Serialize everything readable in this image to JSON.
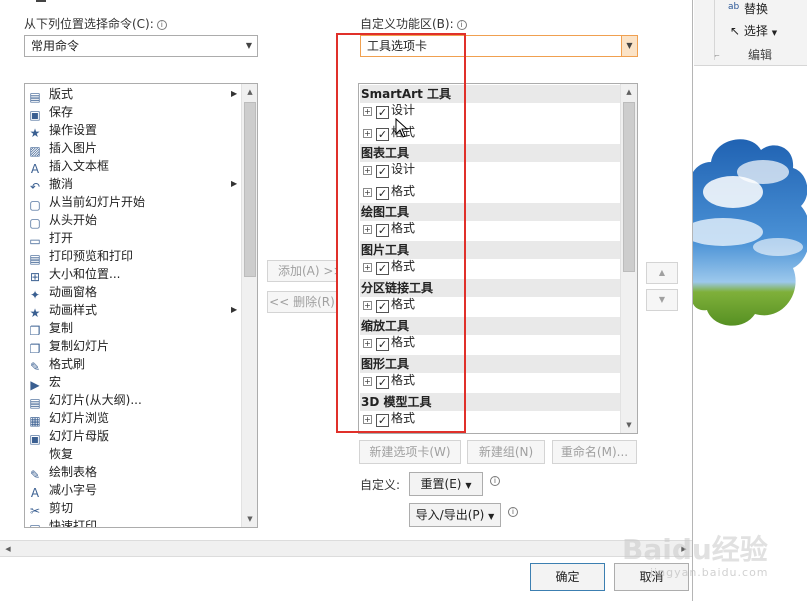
{
  "left_panel": {
    "label": "从下列位置选择命令(C):",
    "combo_value": "常用命令",
    "commands": [
      {
        "label": "版式",
        "icon": "layout-icon",
        "sub": true
      },
      {
        "label": "保存",
        "icon": "save-icon",
        "sub": false
      },
      {
        "label": "操作设置",
        "icon": "action-star-icon",
        "sub": false
      },
      {
        "label": "插入图片",
        "icon": "insert-picture-icon",
        "sub": false
      },
      {
        "label": "插入文本框",
        "icon": "insert-textbox-icon",
        "sub": false
      },
      {
        "label": "撤消",
        "icon": "undo-icon",
        "sub": true
      },
      {
        "label": "从当前幻灯片开始",
        "icon": "slideshow-current-icon",
        "sub": false
      },
      {
        "label": "从头开始",
        "icon": "slideshow-start-icon",
        "sub": false
      },
      {
        "label": "打开",
        "icon": "open-folder-icon",
        "sub": false
      },
      {
        "label": "打印预览和打印",
        "icon": "print-preview-icon",
        "sub": false
      },
      {
        "label": "大小和位置...",
        "icon": "size-position-icon",
        "sub": false
      },
      {
        "label": "动画窗格",
        "icon": "animation-pane-icon",
        "sub": false
      },
      {
        "label": "动画样式",
        "icon": "animation-style-icon",
        "sub": true
      },
      {
        "label": "复制",
        "icon": "copy-icon",
        "sub": false
      },
      {
        "label": "复制幻灯片",
        "icon": "duplicate-slide-icon",
        "sub": false
      },
      {
        "label": "格式刷",
        "icon": "format-painter-icon",
        "sub": false
      },
      {
        "label": "宏",
        "icon": "macro-icon",
        "sub": false
      },
      {
        "label": "幻灯片(从大纲)...",
        "icon": "slides-from-outline-icon",
        "sub": false
      },
      {
        "label": "幻灯片浏览",
        "icon": "slide-sorter-icon",
        "sub": false
      },
      {
        "label": "幻灯片母版",
        "icon": "slide-master-icon",
        "sub": false
      },
      {
        "label": "恢复",
        "icon": "redo-icon",
        "sub": false
      },
      {
        "label": "绘制表格",
        "icon": "draw-table-icon",
        "sub": false
      },
      {
        "label": "减小字号",
        "icon": "decrease-font-icon",
        "sub": false
      },
      {
        "label": "剪切",
        "icon": "cut-icon",
        "sub": false
      },
      {
        "label": "快速打印",
        "icon": "quick-print-icon",
        "sub": false
      }
    ]
  },
  "middle": {
    "add_label": "添加(A) >>",
    "remove_label": "<< 删除(R)"
  },
  "right_panel": {
    "label": "自定义功能区(B):",
    "combo_value": "工具选项卡",
    "tree": [
      {
        "group": "SmartArt 工具",
        "items": [
          "设计",
          "格式"
        ]
      },
      {
        "group": "图表工具",
        "items": [
          "设计",
          "格式"
        ]
      },
      {
        "group": "绘图工具",
        "items": [
          "格式"
        ]
      },
      {
        "group": "图片工具",
        "items": [
          "格式"
        ]
      },
      {
        "group": "分区链接工具",
        "items": [
          "格式"
        ]
      },
      {
        "group": "缩放工具",
        "items": [
          "格式"
        ]
      },
      {
        "group": "图形工具",
        "items": [
          "格式"
        ]
      },
      {
        "group": "3D 模型工具",
        "items": [
          "格式"
        ]
      }
    ],
    "new_tab_label": "新建选项卡(W)",
    "new_group_label": "新建组(N)",
    "rename_label": "重命名(M)...",
    "customize_label": "自定义:",
    "reset_label": "重置(E)",
    "import_export_label": "导入/导出(P)"
  },
  "footer": {
    "ok_label": "确定",
    "cancel_label": "取消"
  },
  "ribbon": {
    "replace_label": "替换",
    "select_label": "选择",
    "group_label": "编辑"
  },
  "watermark": {
    "text": "Baidu经验",
    "url": "jingyan.baidu.com"
  },
  "colors": {
    "highlight_red": "#e0302a",
    "combo_border_orange": "#f0a050",
    "group_bg": "#e9e9e9"
  }
}
